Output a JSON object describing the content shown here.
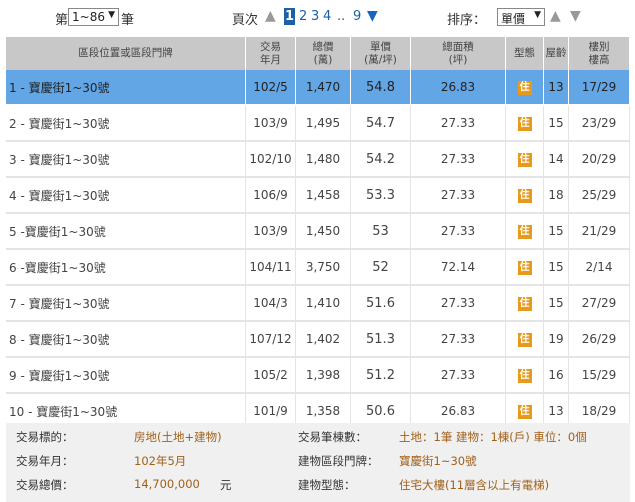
{
  "pager": {
    "prefix": "第",
    "range_value": "1~86",
    "suffix": "筆",
    "page_label": "頁次",
    "current_page": "1",
    "pages": [
      "2",
      "3",
      "4"
    ],
    "ellipsis": "..",
    "last_page": "9",
    "sort_label": "排序：",
    "sort_value": "單價"
  },
  "columns": [
    {
      "label": "區段位置或區段門牌"
    },
    {
      "label": "交易\n年月"
    },
    {
      "label": "總價\n(萬)"
    },
    {
      "label": "單價\n(萬/坪)"
    },
    {
      "label": "總面積\n(坪)"
    },
    {
      "label": "型態"
    },
    {
      "label": "屋齡"
    },
    {
      "label": "樓別\n樓高"
    }
  ],
  "rows": [
    {
      "address": "1 - 寶慶街1~30號",
      "date": "102/5",
      "total": "1,470",
      "unit": "54.8",
      "area": "26.83",
      "type": "住",
      "age": "13",
      "floor": "17/29"
    },
    {
      "address": "2 - 寶慶街1~30號",
      "date": "103/9",
      "total": "1,495",
      "unit": "54.7",
      "area": "27.33",
      "type": "住",
      "age": "15",
      "floor": "23/29"
    },
    {
      "address": "3 - 寶慶街1~30號",
      "date": "102/10",
      "total": "1,480",
      "unit": "54.2",
      "area": "27.33",
      "type": "住",
      "age": "14",
      "floor": "20/29"
    },
    {
      "address": "4 - 寶慶街1~30號",
      "date": "106/9",
      "total": "1,458",
      "unit": "53.3",
      "area": "27.33",
      "type": "住",
      "age": "18",
      "floor": "25/29"
    },
    {
      "address": "5 -寶慶街1~30號",
      "date": "103/9",
      "total": "1,450",
      "unit": "53",
      "area": "27.33",
      "type": "住",
      "age": "15",
      "floor": "21/29"
    },
    {
      "address": "6 -寶慶街1~30號",
      "date": "104/11",
      "total": "3,750",
      "unit": "52",
      "area": "72.14",
      "type": "住",
      "age": "15",
      "floor": "2/14"
    },
    {
      "address": "7 - 寶慶街1~30號",
      "date": "104/3",
      "total": "1,410",
      "unit": "51.6",
      "area": "27.33",
      "type": "住",
      "age": "15",
      "floor": "27/29"
    },
    {
      "address": "8 - 寶慶街1~30號",
      "date": "107/12",
      "total": "1,402",
      "unit": "51.3",
      "area": "27.33",
      "type": "住",
      "age": "19",
      "floor": "26/29"
    },
    {
      "address": "9 - 寶慶街1~30號",
      "date": "105/2",
      "total": "1,398",
      "unit": "51.2",
      "area": "27.33",
      "type": "住",
      "age": "16",
      "floor": "15/29"
    },
    {
      "address": "10 - 寶慶街1~30號",
      "date": "101/9",
      "total": "1,358",
      "unit": "50.6",
      "area": "26.83",
      "type": "住",
      "age": "13",
      "floor": "18/29"
    }
  ],
  "detail": {
    "target_label": "交易標的：",
    "target_value": "房地(土地+建物)",
    "count_label": "交易筆棟數：",
    "count_value": "土地：1筆 建物：1棟(戶) 車位：0個",
    "date_label": "交易年月：",
    "date_value": "102年5月",
    "addr_label": "建物區段門牌：",
    "addr_value": "寶慶街1~30號",
    "total_label": "交易總價：",
    "total_value": "14,700,000",
    "total_unit": "元",
    "type_label": "建物型態：",
    "type_value": "住宅大樓(11層含以上有電梯)"
  },
  "colors": {
    "header_bg": "#c8c8c8",
    "selected_row": "#62a6e6",
    "badge": "#e59a1c",
    "accent": "#1e5fa8"
  }
}
